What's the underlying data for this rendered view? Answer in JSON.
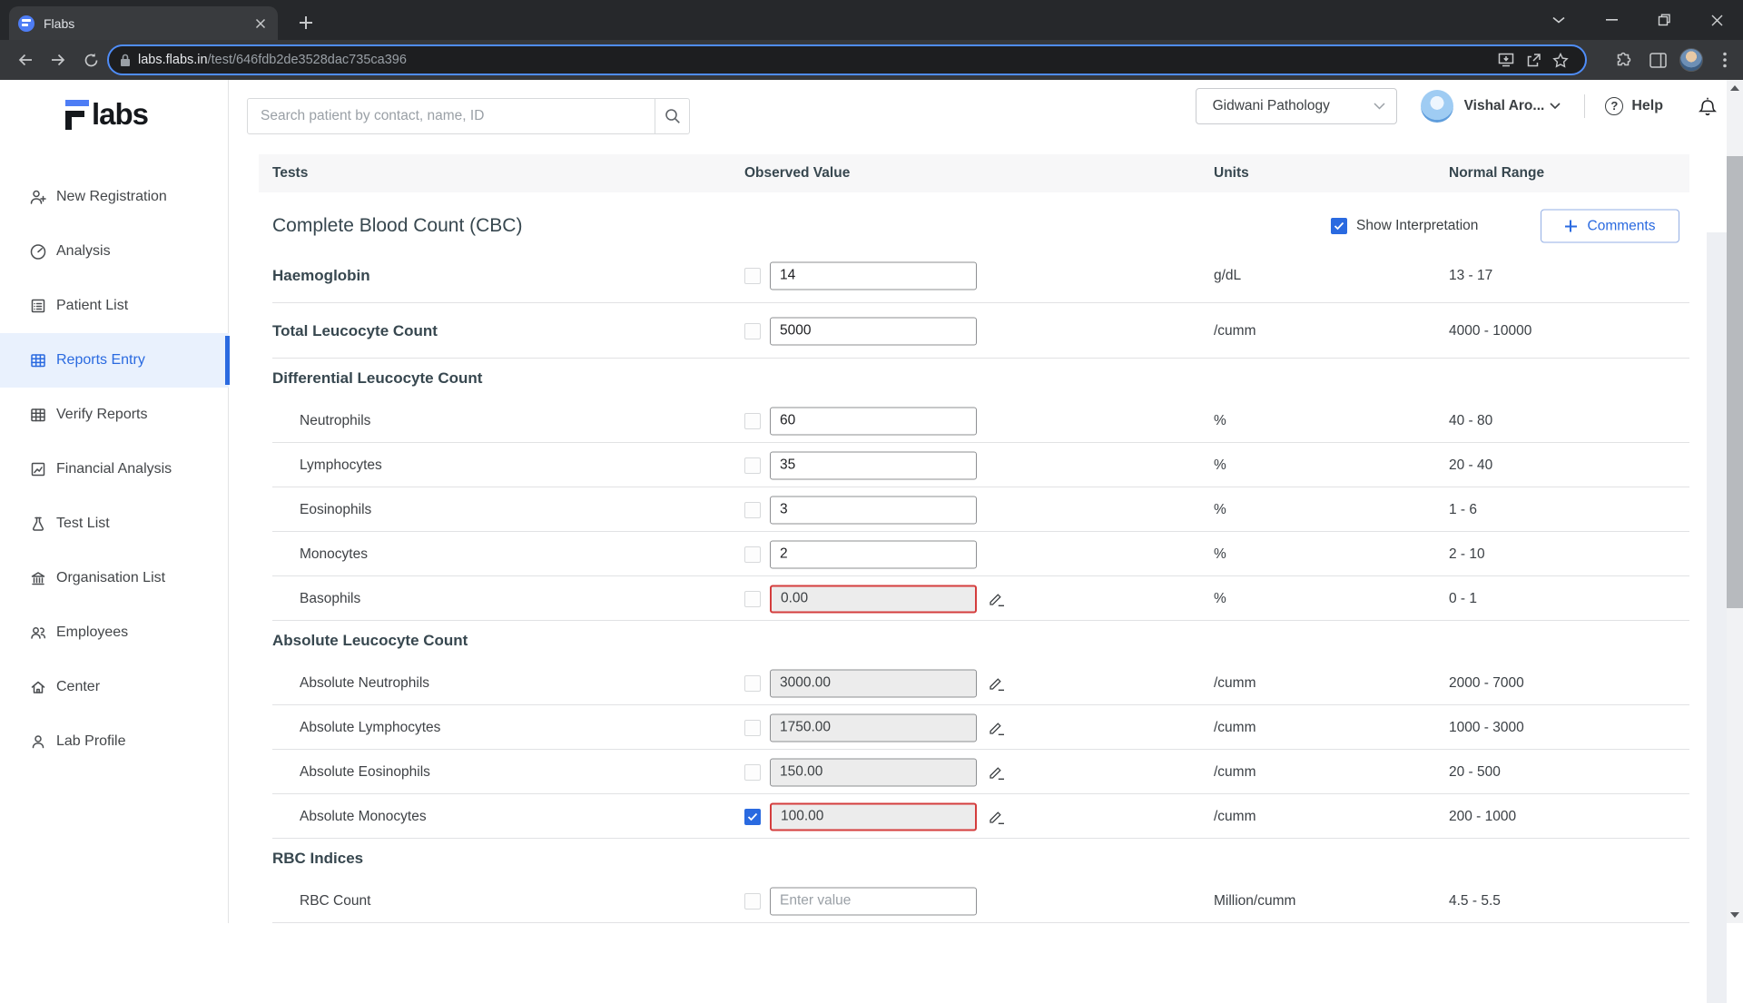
{
  "browser": {
    "tab_title": "Flabs",
    "url_host": "labs.flabs.in",
    "url_path": "/test/646fdb2de3528dac735ca396"
  },
  "logo": {
    "name": "Flabs",
    "wordmark_suffix": "labs"
  },
  "header": {
    "search_placeholder": "Search patient by contact, name, ID",
    "org_selected": "Gidwani Pathology",
    "user_name": "Vishal Aro...",
    "help_label": "Help"
  },
  "sidebar": {
    "items": [
      {
        "label": "New Registration",
        "icon": "person-add-icon",
        "active": false
      },
      {
        "label": "Analysis",
        "icon": "gauge-icon",
        "active": false
      },
      {
        "label": "Patient List",
        "icon": "list-icon",
        "active": false
      },
      {
        "label": "Reports Entry",
        "icon": "table-grid-icon",
        "active": true
      },
      {
        "label": "Verify Reports",
        "icon": "table-grid-icon",
        "active": false
      },
      {
        "label": "Financial Analysis",
        "icon": "chart-icon",
        "active": false
      },
      {
        "label": "Test List",
        "icon": "flask-icon",
        "active": false
      },
      {
        "label": "Organisation List",
        "icon": "bank-icon",
        "active": false
      },
      {
        "label": "Employees",
        "icon": "people-icon",
        "active": false
      },
      {
        "label": "Center",
        "icon": "home-icon",
        "active": false
      },
      {
        "label": "Lab Profile",
        "icon": "person-icon",
        "active": false
      }
    ]
  },
  "table": {
    "columns": [
      "Tests",
      "Observed Value",
      "Units",
      "Normal Range"
    ],
    "section": {
      "title": "Complete Blood Count (CBC)",
      "show_interpretation_label": "Show Interpretation",
      "interpretation_checked": true,
      "comments_label": "Comments"
    },
    "rows": [
      {
        "type": "test",
        "label": "Haemoglobin",
        "level": 0,
        "checked": false,
        "value": "14",
        "placeholder": "",
        "disabled": false,
        "error": false,
        "edit": false,
        "units": "g/dL",
        "range": "13 - 17"
      },
      {
        "type": "test",
        "label": "Total Leucocyte Count",
        "level": 0,
        "checked": false,
        "value": "5000",
        "placeholder": "",
        "disabled": false,
        "error": false,
        "edit": false,
        "units": "/cumm",
        "range": "4000 - 10000"
      },
      {
        "type": "group",
        "label": "Differential Leucocyte Count"
      },
      {
        "type": "test",
        "label": "Neutrophils",
        "level": 1,
        "checked": false,
        "value": "60",
        "placeholder": "",
        "disabled": false,
        "error": false,
        "edit": false,
        "units": "%",
        "range": "40 - 80"
      },
      {
        "type": "test",
        "label": "Lymphocytes",
        "level": 1,
        "checked": false,
        "value": "35",
        "placeholder": "",
        "disabled": false,
        "error": false,
        "edit": false,
        "units": "%",
        "range": "20 - 40"
      },
      {
        "type": "test",
        "label": "Eosinophils",
        "level": 1,
        "checked": false,
        "value": "3",
        "placeholder": "",
        "disabled": false,
        "error": false,
        "edit": false,
        "units": "%",
        "range": "1 - 6"
      },
      {
        "type": "test",
        "label": "Monocytes",
        "level": 1,
        "checked": false,
        "value": "2",
        "placeholder": "",
        "disabled": false,
        "error": false,
        "edit": false,
        "units": "%",
        "range": "2 - 10"
      },
      {
        "type": "test",
        "label": "Basophils",
        "level": 1,
        "checked": false,
        "value": "0.00",
        "placeholder": "",
        "disabled": true,
        "error": true,
        "edit": true,
        "units": "%",
        "range": "0 - 1"
      },
      {
        "type": "group",
        "label": "Absolute Leucocyte Count"
      },
      {
        "type": "test",
        "label": "Absolute Neutrophils",
        "level": 1,
        "checked": false,
        "value": "3000.00",
        "placeholder": "",
        "disabled": true,
        "error": false,
        "edit": true,
        "units": "/cumm",
        "range": "2000 - 7000"
      },
      {
        "type": "test",
        "label": "Absolute Lymphocytes",
        "level": 1,
        "checked": false,
        "value": "1750.00",
        "placeholder": "",
        "disabled": true,
        "error": false,
        "edit": true,
        "units": "/cumm",
        "range": "1000 - 3000"
      },
      {
        "type": "test",
        "label": "Absolute Eosinophils",
        "level": 1,
        "checked": false,
        "value": "150.00",
        "placeholder": "",
        "disabled": true,
        "error": false,
        "edit": true,
        "units": "/cumm",
        "range": "20 - 500"
      },
      {
        "type": "test",
        "label": "Absolute Monocytes",
        "level": 1,
        "checked": true,
        "value": "100.00",
        "placeholder": "",
        "disabled": true,
        "error": true,
        "edit": true,
        "units": "/cumm",
        "range": "200 - 1000"
      },
      {
        "type": "group",
        "label": "RBC Indices"
      },
      {
        "type": "test",
        "label": "RBC Count",
        "level": 1,
        "checked": false,
        "value": "",
        "placeholder": "Enter value",
        "disabled": false,
        "error": false,
        "edit": false,
        "units": "Million/cumm",
        "range": "4.5 - 5.5"
      }
    ]
  },
  "colors": {
    "accent_blue": "#2a6ae0",
    "error_red": "#d43d3d",
    "sidebar_active_bg": "#e9f1fd",
    "disabled_input_bg": "#ececec",
    "table_header_bg": "#f7f7f8",
    "url_focus_ring": "#4f8df8",
    "browser_frame": "#26282b",
    "browser_toolbar": "#36383b"
  }
}
